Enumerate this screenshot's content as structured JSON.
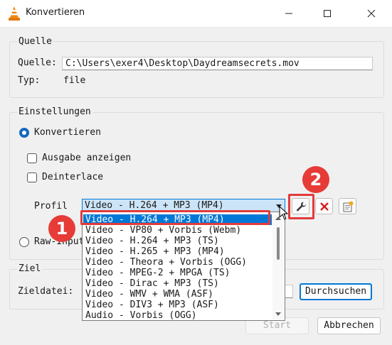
{
  "window": {
    "title": "Konvertieren",
    "controls": [
      "minimize-icon",
      "maximize-icon",
      "close-icon"
    ]
  },
  "source": {
    "group_label": "Quelle",
    "field_label": "Quelle:",
    "path": "C:\\Users\\exer4\\Desktop\\Daydreamsecrets.mov",
    "type_label": "Typ:",
    "type_value": "file"
  },
  "settings": {
    "group_label": "Einstellungen",
    "convert_radio": "Konvertieren",
    "convert_selected": true,
    "show_output": "Ausgabe anzeigen",
    "deinterlace": "Deinterlace",
    "profile_label": "Profil",
    "profile_selected": "Video - H.264 + MP3 (MP4)",
    "raw_input_radio": "Raw-Input"
  },
  "profile_dropdown": {
    "selected_index": 0,
    "options": [
      "Video - H.264 + MP3 (MP4)",
      "Video - VP80 + Vorbis (Webm)",
      "Video - H.264 + MP3 (TS)",
      "Video - H.265 + MP3 (MP4)",
      "Video - Theora + Vorbis (OGG)",
      "Video - MPEG-2 + MPGA (TS)",
      "Video - Dirac + MP3 (TS)",
      "Video - WMV + WMA (ASF)",
      "Video - DIV3 + MP3 (ASF)",
      "Audio - Vorbis (OGG)"
    ]
  },
  "target": {
    "group_label": "Ziel",
    "file_label": "Zieldatei:",
    "browse_button": "Durchsuchen"
  },
  "footer": {
    "start_button": "Start",
    "cancel_button": "Abbrechen"
  },
  "annotations": {
    "marker_1": "1",
    "marker_2": "2",
    "color": "#e63b37"
  },
  "colors": {
    "accent": "#0078d7",
    "selection": "#cce4f7"
  }
}
